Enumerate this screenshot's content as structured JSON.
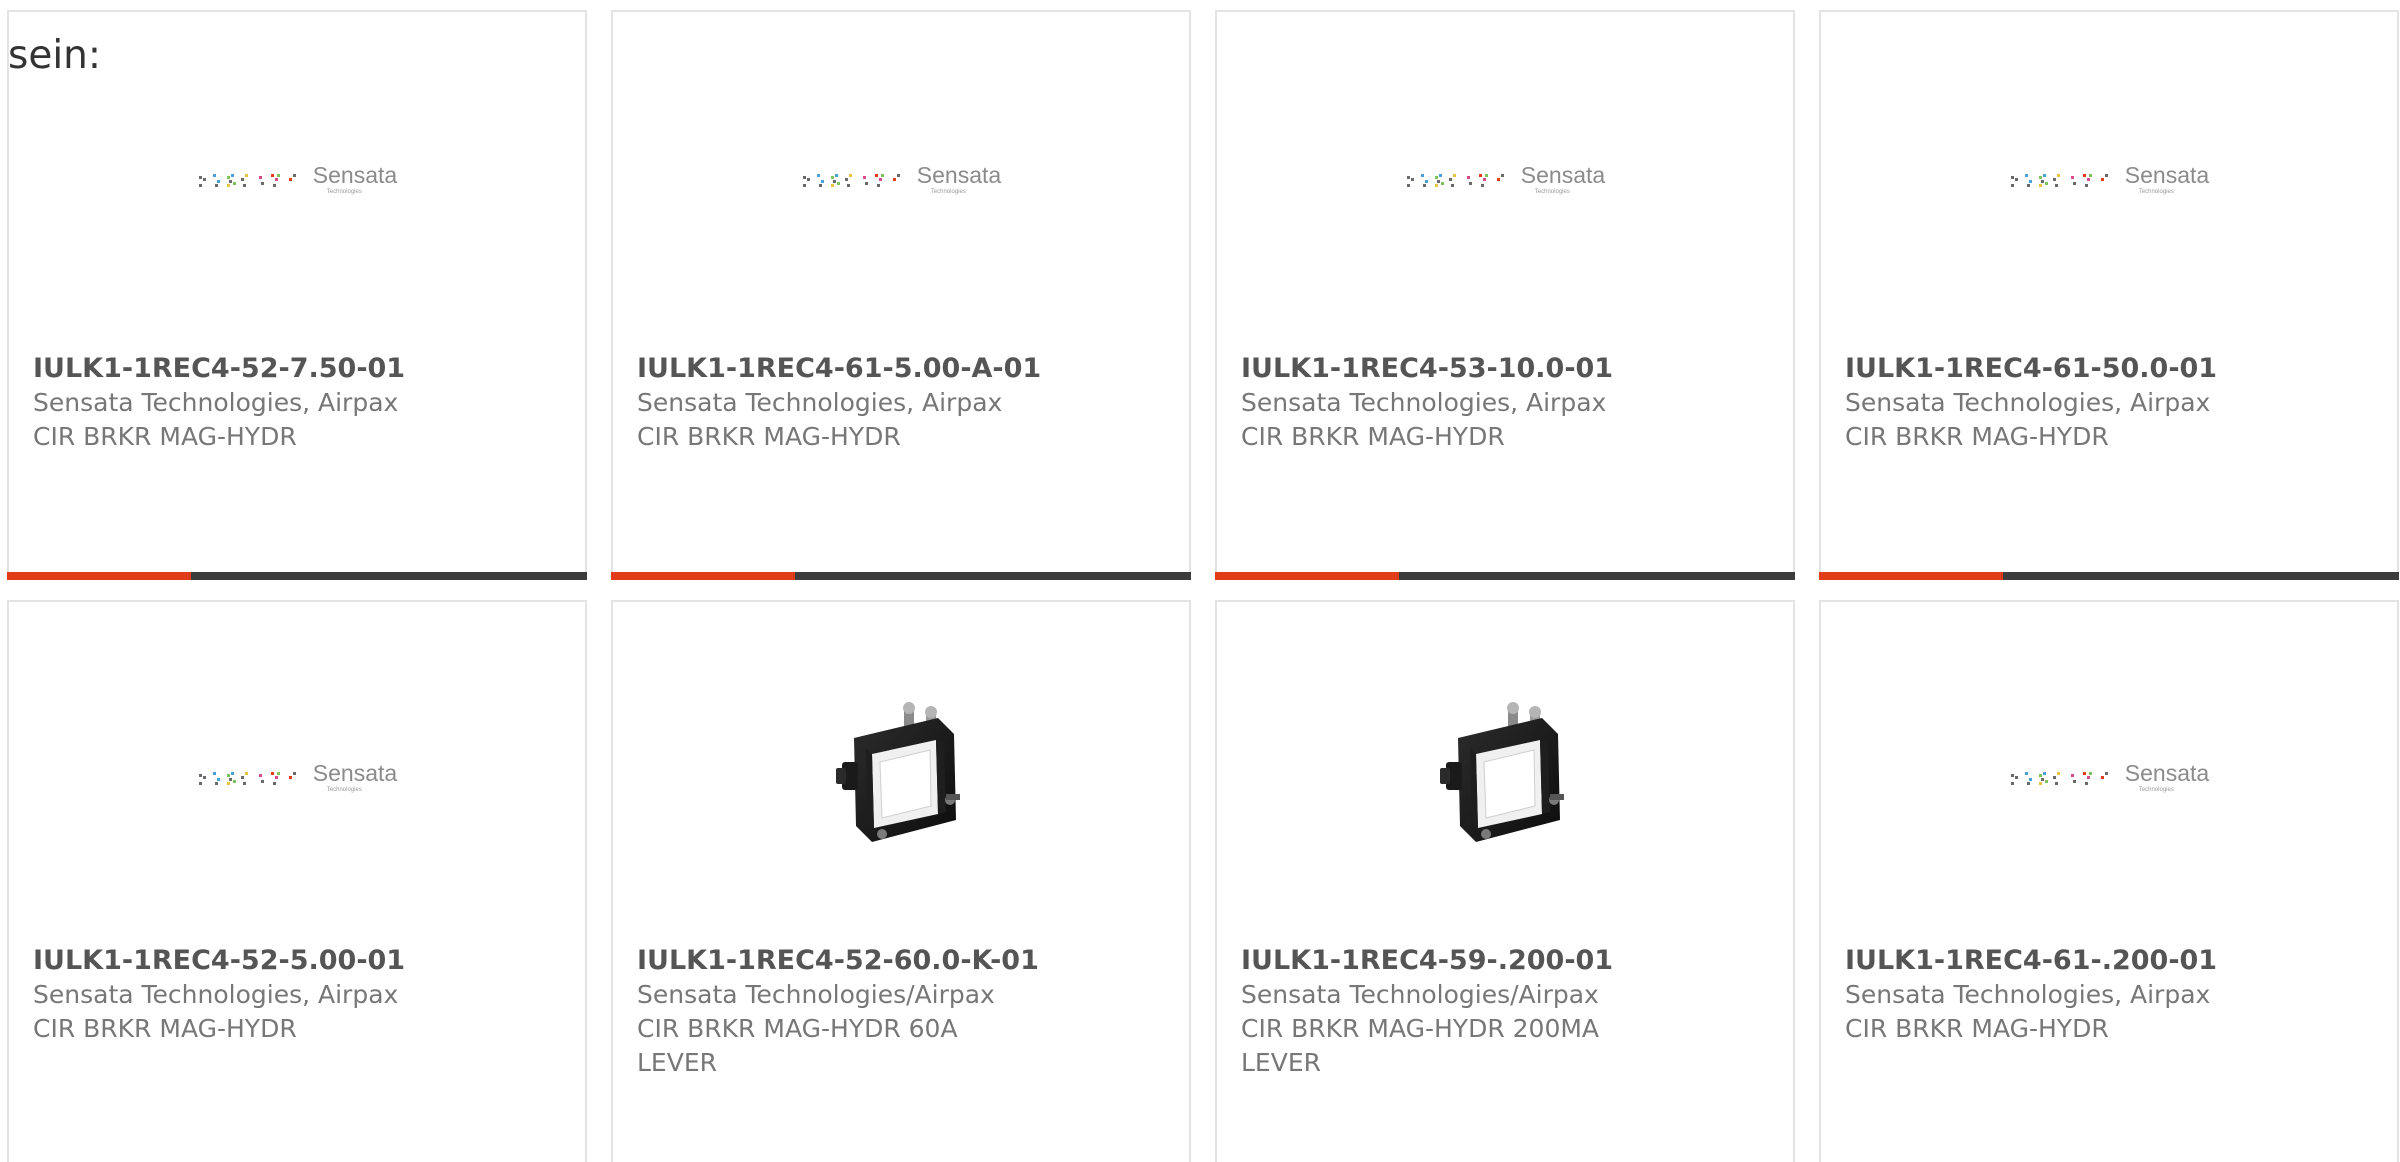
{
  "intro": "sein:",
  "colors": {
    "accent": "#e23d18",
    "bar": "#3c3c3c",
    "border": "#e3e3e3"
  },
  "products": [
    {
      "part_number": "IULK1-1REC4-52-7.50-01",
      "manufacturer": "Sensata Technologies, Airpax",
      "description": "CIR BRKR MAG-HYDR",
      "image": "sensata-logo",
      "logo_name": "Sensata",
      "logo_sub": "Technologies"
    },
    {
      "part_number": "IULK1-1REC4-61-5.00-A-01",
      "manufacturer": "Sensata Technologies, Airpax",
      "description": "CIR BRKR MAG-HYDR",
      "image": "sensata-logo",
      "logo_name": "Sensata",
      "logo_sub": "Technologies"
    },
    {
      "part_number": "IULK1-1REC4-53-10.0-01",
      "manufacturer": "Sensata Technologies, Airpax",
      "description": "CIR BRKR MAG-HYDR",
      "image": "sensata-logo",
      "logo_name": "Sensata",
      "logo_sub": "Technologies"
    },
    {
      "part_number": "IULK1-1REC4-61-50.0-01",
      "manufacturer": "Sensata Technologies, Airpax",
      "description": "CIR BRKR MAG-HYDR",
      "image": "sensata-logo",
      "logo_name": "Sensata",
      "logo_sub": "Technologies"
    },
    {
      "part_number": "IULK1-1REC4-52-5.00-01",
      "manufacturer": "Sensata Technologies, Airpax",
      "description": "CIR BRKR MAG-HYDR",
      "image": "sensata-logo",
      "logo_name": "Sensata",
      "logo_sub": "Technologies"
    },
    {
      "part_number": "IULK1-1REC4-52-60.0-K-01",
      "manufacturer": "Sensata Technologies/Airpax",
      "description": "CIR BRKR MAG-HYDR 60A LEVER",
      "image": "circuit-breaker-photo"
    },
    {
      "part_number": "IULK1-1REC4-59-.200-01",
      "manufacturer": "Sensata Technologies/Airpax",
      "description": "CIR BRKR MAG-HYDR 200MA LEVER",
      "image": "circuit-breaker-photo"
    },
    {
      "part_number": "IULK1-1REC4-61-.200-01",
      "manufacturer": "Sensata Technologies, Airpax",
      "description": "CIR BRKR MAG-HYDR",
      "image": "sensata-logo",
      "logo_name": "Sensata",
      "logo_sub": "Technologies"
    }
  ]
}
